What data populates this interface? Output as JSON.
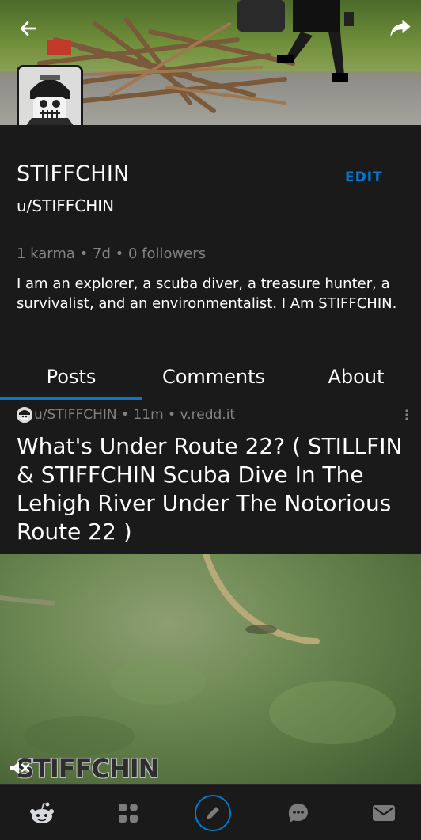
{
  "header": {
    "back_icon": "arrow-left-icon",
    "share_icon": "share-icon"
  },
  "profile": {
    "display_name": "STIFFCHIN",
    "username": "u/STIFFCHIN",
    "edit_label": "EDIT",
    "stats": "1 karma • 7d • 0 followers",
    "bio": "I am an explorer, a scuba diver, a treasure hunter, a survivalist, and an environmentalist. I Am STIFFCHIN."
  },
  "tabs": [
    {
      "label": "Posts",
      "active": true
    },
    {
      "label": "Comments",
      "active": false
    },
    {
      "label": "About",
      "active": false
    }
  ],
  "post": {
    "meta": "u/STIFFCHIN • 11m • v.redd.it",
    "title": "What's Under Route 22? ( STILLFIN & STIFFCHIN Scuba Dive In The Lehigh River Under The Notorious Route 22 )",
    "video_watermark": "STIFFCHIN"
  },
  "bottom_nav": [
    {
      "icon": "reddit-home-icon"
    },
    {
      "icon": "communities-icon"
    },
    {
      "icon": "create-post-icon"
    },
    {
      "icon": "chat-icon"
    },
    {
      "icon": "inbox-icon"
    }
  ],
  "colors": {
    "accent": "#0079d3",
    "background": "#1a1a1b",
    "muted_text": "#818384"
  }
}
